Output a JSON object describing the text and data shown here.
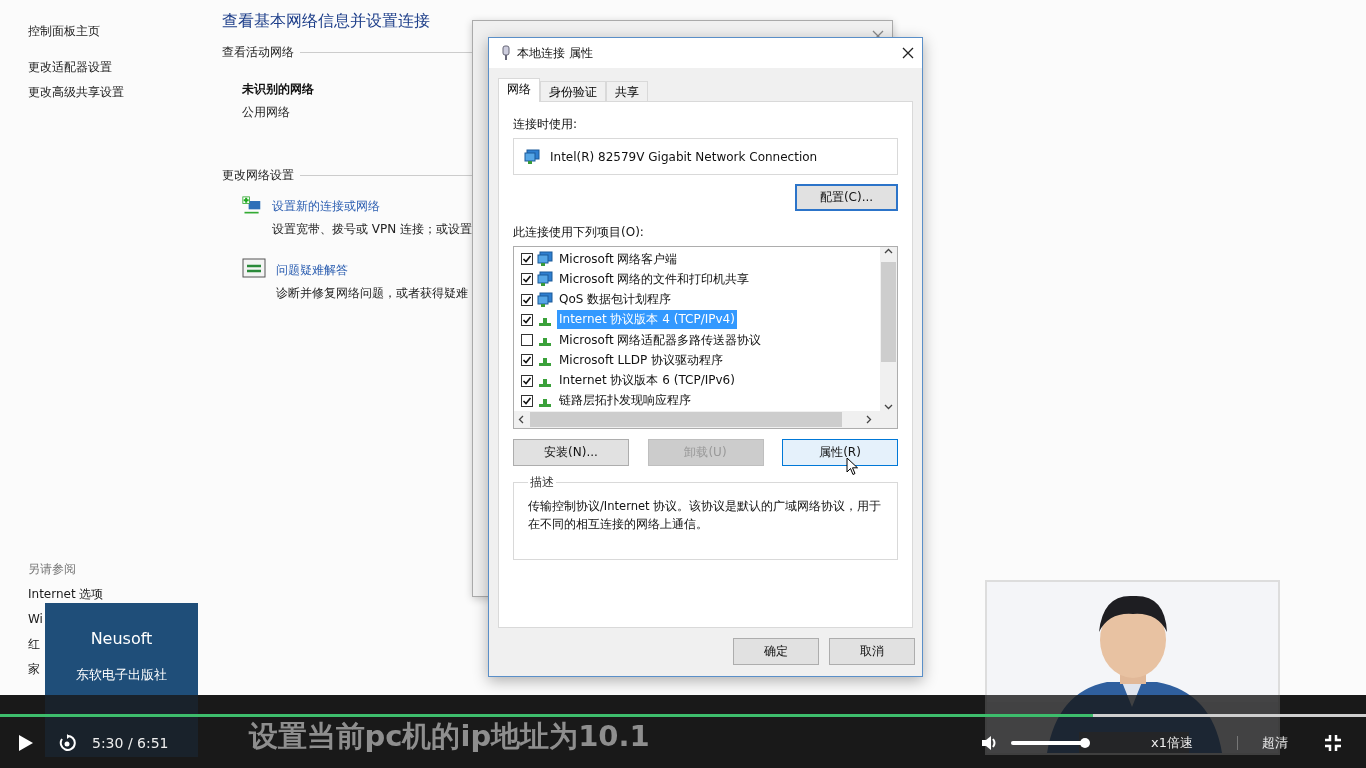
{
  "sidebar": {
    "items": [
      {
        "label": "控制面板主页"
      },
      {
        "label": "更改适配器设置"
      },
      {
        "label": "更改高级共享设置"
      }
    ],
    "see_also": {
      "title": "另请参阅",
      "items": [
        "Internet 选项",
        "Wi",
        "红",
        "家"
      ]
    }
  },
  "main": {
    "title": "查看基本网络信息并设置连接",
    "active_networks": {
      "heading": "查看活动网络",
      "name": "未识别的网络",
      "type": "公用网络"
    },
    "change_settings": {
      "heading": "更改网络设置",
      "tasks": [
        {
          "kind": "setup",
          "link": "设置新的连接或网络",
          "description": "设置宽带、拨号或 VPN 连接；或设置"
        },
        {
          "kind": "troubleshoot",
          "link": "问题疑难解答",
          "description": "诊断并修复网络问题，或者获得疑难"
        }
      ]
    }
  },
  "dialog": {
    "title": "本地连接 属性",
    "tabs": [
      {
        "label": "网络",
        "selected": true
      },
      {
        "label": "身份验证",
        "selected": false
      },
      {
        "label": "共享",
        "selected": false
      }
    ],
    "connect_using_label": "连接时使用:",
    "adapter": "Intel(R) 82579V Gigabit Network Connection",
    "configure_button": {
      "label": "配置(C)...",
      "focused": true
    },
    "items_label": "此连接使用下列项目(O):",
    "items": [
      {
        "kind": "service",
        "label": "Microsoft 网络客户端",
        "checked": true,
        "selected": false
      },
      {
        "kind": "service",
        "label": "Microsoft 网络的文件和打印机共享",
        "checked": true,
        "selected": false
      },
      {
        "kind": "service",
        "label": "QoS 数据包计划程序",
        "checked": true,
        "selected": false
      },
      {
        "kind": "protocol",
        "label": "Internet 协议版本 4 (TCP/IPv4)",
        "checked": true,
        "selected": true
      },
      {
        "kind": "protocol",
        "label": "Microsoft 网络适配器多路传送器协议",
        "checked": false,
        "selected": false
      },
      {
        "kind": "protocol",
        "label": "Microsoft LLDP 协议驱动程序",
        "checked": true,
        "selected": false
      },
      {
        "kind": "protocol",
        "label": "Internet 协议版本 6 (TCP/IPv6)",
        "checked": true,
        "selected": false
      },
      {
        "kind": "protocol",
        "label": "链路层拓扑发现响应程序",
        "checked": true,
        "selected": false
      }
    ],
    "buttons": [
      {
        "label": "安装(N)...",
        "disabled": false,
        "hovered": false
      },
      {
        "label": "卸载(U)",
        "disabled": true,
        "hovered": false
      },
      {
        "label": "属性(R)",
        "disabled": false,
        "hovered": true
      }
    ],
    "description": {
      "title": "描述",
      "text": "传输控制协议/Internet 协议。该协议是默认的广域网络协议，用于在不同的相互连接的网络上通信。"
    },
    "footer_buttons": [
      "确定",
      "取消"
    ]
  },
  "overlay": {
    "brand": "Neusoft",
    "publisher": "东软电子出版社"
  },
  "player": {
    "progress": {
      "level": 0.8
    },
    "time": "5:30 / 6:51",
    "subtitle": "设置当前pc机的ip地址为10.1",
    "volume": {
      "level": 1
    },
    "speed": "x1倍速",
    "quality": "超清"
  }
}
